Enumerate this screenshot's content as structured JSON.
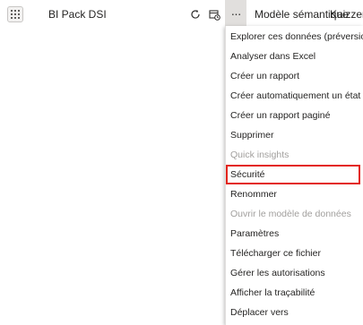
{
  "row": {
    "name": "BI Pack DSI",
    "type": "Modèle sémantique",
    "owner": "Kaizzen A"
  },
  "icons": {
    "app_grid": "grid-icon",
    "refresh": "refresh-icon",
    "schedule": "schedule-refresh-icon",
    "more": "more-options-icon"
  },
  "more_label": "···",
  "menu": {
    "items": [
      {
        "label": "Explorer ces données (préversion)",
        "disabled": false
      },
      {
        "label": "Analyser dans Excel",
        "disabled": false
      },
      {
        "label": "Créer un rapport",
        "disabled": false
      },
      {
        "label": "Créer automatiquement un état",
        "disabled": false
      },
      {
        "label": "Créer un rapport paginé",
        "disabled": false
      },
      {
        "label": "Supprimer",
        "disabled": false
      },
      {
        "label": "Quick insights",
        "disabled": true
      },
      {
        "label": "Sécurité",
        "disabled": false,
        "highlighted": true
      },
      {
        "label": "Renommer",
        "disabled": false
      },
      {
        "label": "Ouvrir le modèle de données",
        "disabled": true
      },
      {
        "label": "Paramètres",
        "disabled": false
      },
      {
        "label": "Télécharger ce fichier",
        "disabled": false
      },
      {
        "label": "Gérer les autorisations",
        "disabled": false
      },
      {
        "label": "Afficher la traçabilité",
        "disabled": false
      },
      {
        "label": "Déplacer vers",
        "disabled": false
      }
    ]
  },
  "colors": {
    "highlight_border": "#e3241b",
    "disabled_text": "#a19f9d",
    "text": "#252423"
  }
}
